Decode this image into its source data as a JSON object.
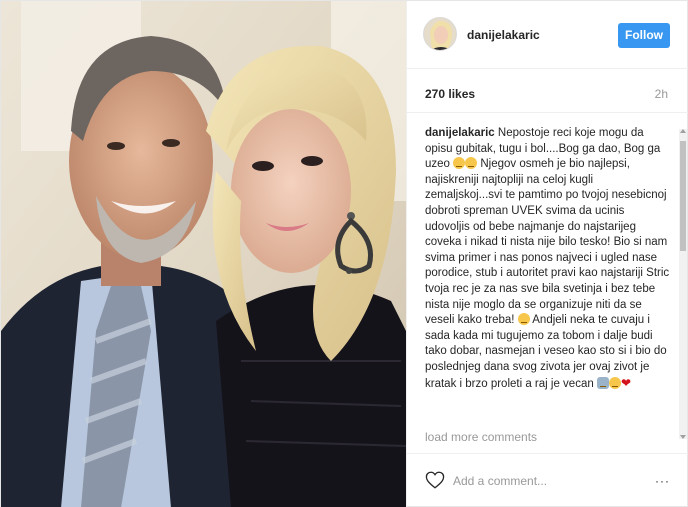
{
  "post": {
    "username": "danijelakaric",
    "follow_label": "Follow",
    "likes": "270 likes",
    "time_ago": "2h",
    "caption": {
      "author": "danijelakaric",
      "part1": " Nepostoje reci koje mogu da opisu gubitak, tugu i bol....Bog ga dao, Bog ga uzeo",
      "part2": " Njegov osmeh je bio najlepsi, najiskreniji najtopliji na celoj kugli zemaljskoj...svi te pamtimo po tvojoj nesebicnoj dobroti spreman UVEK svima da ucinis udovoljis od bebe najmanje do najstarijeg coveka i nikad ti nista nije bilo tesko! Bio si nam svima primer i nas ponos najveci i ugled nase porodice, stub i autoritet pravi kao najstariji Stric tvoja rec je za nas sve bila svetinja i bez tebe nista nije moglo da se organizuje niti da se veseli kako treba!",
      "part3": " Andjeli neka te cuvaju i sada kada mi tugujemo za tobom i dalje budi tako dobar, nasmejan i veseo kao sto si i bio do poslednjeg dana svog zivota jer ovaj zivot je kratak i brzo proleti a raj je vecan"
    },
    "load_more": "load more comments",
    "comment_placeholder": "Add a comment...",
    "more_label": "···",
    "heart_glyph": "❤"
  },
  "icons": {
    "like": "heart-outline-icon",
    "more": "more-options-icon"
  },
  "colors": {
    "accent": "#3897f0",
    "muted": "#999999",
    "heart": "#d4141c"
  }
}
